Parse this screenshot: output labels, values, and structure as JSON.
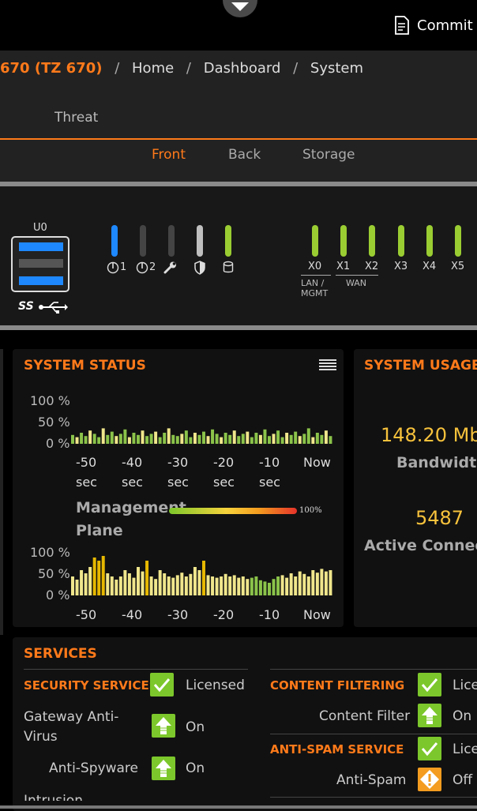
{
  "header": {
    "commit_label": "Commit &"
  },
  "breadcrumb": {
    "device": "670 (TZ 670)",
    "items": [
      "Home",
      "Dashboard",
      "System"
    ],
    "separator": "/"
  },
  "tabs": {
    "threat": "Threat",
    "sub": [
      "Front",
      "Back",
      "Storage"
    ],
    "active_sub": "Front"
  },
  "device": {
    "usb_label": "U0",
    "usb_speed": "SS",
    "leds": [
      {
        "label": "1",
        "color": "#1e88ff"
      },
      {
        "label": "2",
        "color": "#444444"
      },
      {
        "label": "",
        "color": "#444444"
      },
      {
        "label": "",
        "color": "#bfbfbf"
      },
      {
        "label": "",
        "color": "#9acd32"
      }
    ],
    "ports": [
      "X0",
      "X1",
      "X2",
      "X3",
      "X4",
      "X5"
    ],
    "port_color": "#9acd32",
    "lan_label": "LAN / MGMT",
    "wan_label": "WAN"
  },
  "system_status": {
    "title": "SYSTEM STATUS",
    "y_ticks": [
      "100 %",
      "50 %",
      "0 %"
    ],
    "x_ticks": [
      "-50",
      "-40",
      "-30",
      "-20",
      "-10",
      "Now"
    ],
    "x_unit": "sec",
    "mp_label_1": "Management",
    "mp_label_2": "Plane",
    "gauge_label": "100%",
    "chart_data": [
      {
        "type": "bar",
        "title": "",
        "ylim": [
          0,
          100
        ],
        "values": [
          8,
          6,
          10,
          7,
          12,
          9,
          6,
          14,
          8,
          11,
          7,
          9,
          13,
          6,
          10,
          8,
          12,
          7,
          9,
          11,
          6,
          10,
          14,
          8,
          7,
          9,
          12,
          6,
          10,
          8,
          11,
          7,
          13,
          9,
          6,
          10,
          8,
          12,
          7,
          9,
          11,
          6,
          10,
          8,
          13,
          7,
          9,
          12,
          6,
          10,
          8,
          11,
          7,
          9,
          14,
          6,
          10,
          8,
          12,
          7
        ]
      },
      {
        "type": "bar",
        "title": "",
        "ylim": [
          0,
          100
        ],
        "values": [
          30,
          25,
          40,
          35,
          45,
          60,
          55,
          70,
          35,
          30,
          25,
          30,
          40,
          35,
          28,
          45,
          38,
          55,
          30,
          26,
          40,
          35,
          30,
          28,
          32,
          36,
          30,
          34,
          45,
          40,
          55,
          32,
          30,
          28,
          30,
          34,
          30,
          32,
          28,
          30,
          26,
          28,
          30,
          24,
          22,
          20,
          26,
          30,
          32,
          28,
          35,
          30,
          38,
          34,
          30,
          40,
          36,
          42,
          38,
          40
        ]
      }
    ]
  },
  "system_usage": {
    "title": "SYSTEM USAGE",
    "bandwidth_value": "148.20 Mb",
    "bandwidth_label": "Bandwidth",
    "connections_value": "5487",
    "connections_label": "Active Connec"
  },
  "services": {
    "title": "SERVICES",
    "security_head": "SECURITY SERVICES",
    "security_status": "Licensed",
    "gav_label_1": "Gateway Anti-",
    "gav_label_2": "Virus",
    "gav_status": "On",
    "antispyware_label": "Anti-Spyware",
    "antispyware_status": "On",
    "intrusion_label": "Intrusion",
    "cf_head": "CONTENT FILTERING",
    "cf_status": "Lice",
    "cf_label": "Content Filter",
    "cf_state": "On",
    "as_head": "ANTI-SPAM SERVICE",
    "as_status": "Lice",
    "as_label": "Anti-Spam",
    "as_state": "Off"
  }
}
